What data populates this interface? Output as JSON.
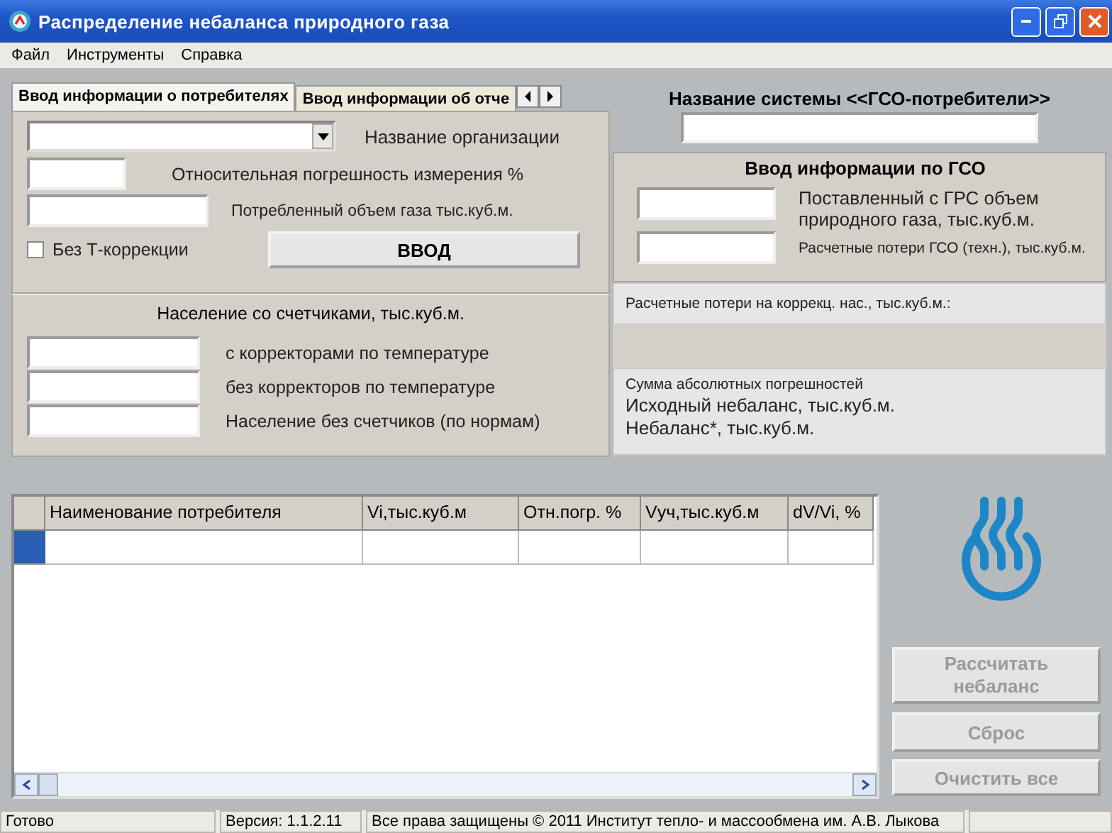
{
  "window": {
    "title": "Распределение небаланса природного газа"
  },
  "menu": [
    "Файл",
    "Инструменты",
    "Справка"
  ],
  "tabs": [
    {
      "label": "Ввод информации о потребителях",
      "selected": true
    },
    {
      "label": "Ввод информации об отче",
      "selected": false
    }
  ],
  "consumer_form": {
    "combo_label": "Название организации",
    "fields": [
      "Относительная погрешность измерения %",
      "Потребленный объем газа тыс.куб.м."
    ],
    "checkbox": {
      "label": "Без Т-коррекции",
      "checked": false
    },
    "button": "ВВОД"
  },
  "population": {
    "title": "Население со счетчиками, тыс.куб.м.",
    "fields": [
      "с корректорами по температуре",
      "без корректоров по температуре",
      "Население без счетчиков (по нормам)"
    ]
  },
  "system_name": {
    "label": "Название системы <<ГСО-потребители>>"
  },
  "gso": {
    "title": "Ввод информации по ГСО",
    "fields": [
      "Поставленный с ГРС объем природного газа, тыс.куб.м.",
      "Расчетные потери ГСО (техн.), тыс.куб.м."
    ],
    "loss_label": "Расчетные потери на коррекц. нас., тыс.куб.м.:",
    "sums": [
      "Сумма абсолютных погрешностей",
      "Исходный небаланс, тыс.куб.м.",
      "Небаланс*, тыс.куб.м."
    ]
  },
  "table": {
    "columns": [
      "Наименование потребителя",
      "Vi,тыс.куб.м",
      "Отн.погр. %",
      "Vуч,тыс.куб.м",
      "dV/Vi, %"
    ],
    "rows": [
      {
        "selected": true
      }
    ]
  },
  "buttons": [
    {
      "label": "Рассчитать небаланс",
      "disabled": true
    },
    {
      "label": "Сброс",
      "disabled": true
    },
    {
      "label": "Очистить все",
      "disabled": true
    }
  ],
  "status_bar": [
    "Готово",
    "Версия: 1.1.2.11",
    "Все права защищены © 2011   Институт тепло- и массообмена им. А.В. Лыкова"
  ]
}
